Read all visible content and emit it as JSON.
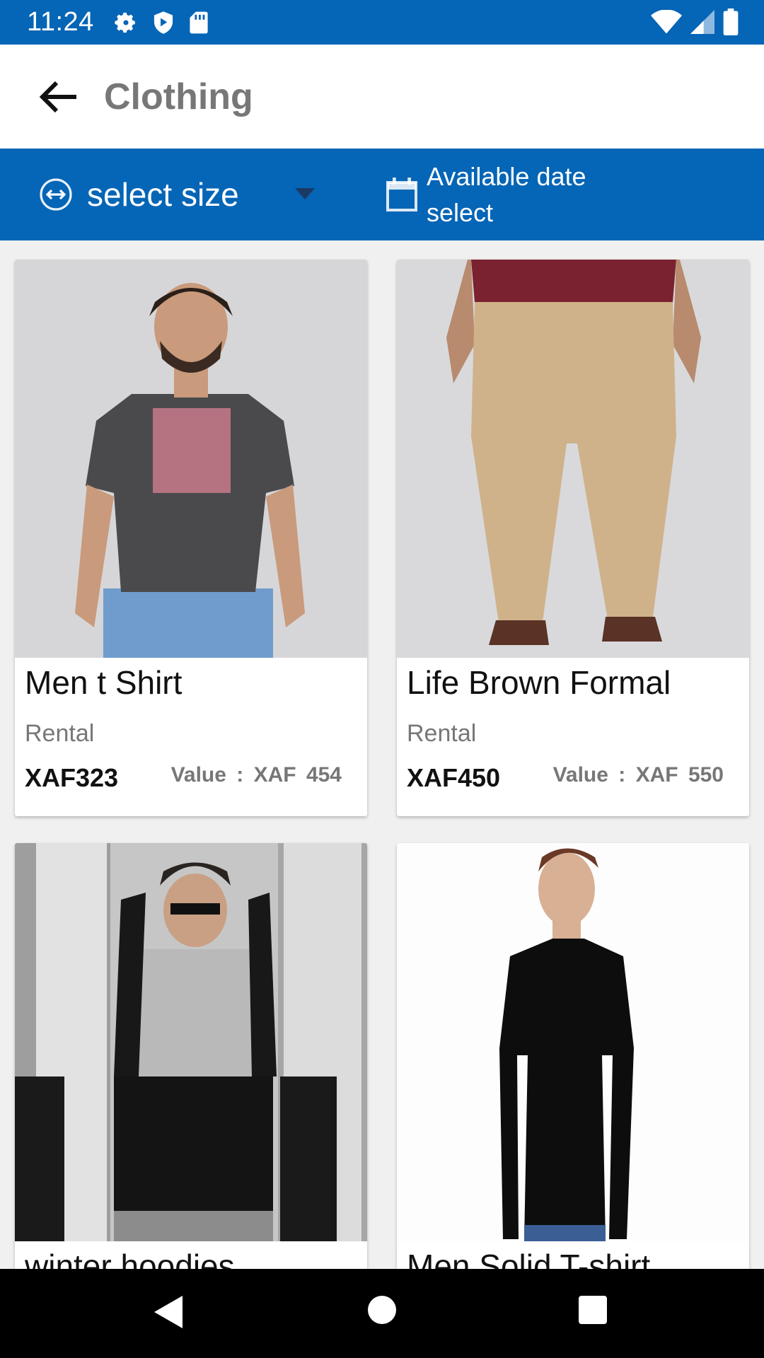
{
  "status_bar": {
    "time": "11:24"
  },
  "app_bar": {
    "title": "Clothing"
  },
  "filters": {
    "size_label": "select size",
    "date_label": "Available date select"
  },
  "products": [
    {
      "name": "Men t Shirt",
      "type": "Rental",
      "price": "XAF323",
      "value_label": "Value : XAF 454"
    },
    {
      "name": "Life Brown Formal",
      "type": "Rental",
      "price": "XAF450",
      "value_label": "Value : XAF 550"
    },
    {
      "name": "winter hoodies",
      "type": "",
      "price": "",
      "value_label": ""
    },
    {
      "name": "Men Solid T-shirt",
      "type": "",
      "price": "",
      "value_label": ""
    }
  ],
  "colors": {
    "primary": "#0565b6",
    "background": "#f0f0f0"
  },
  "icons": [
    "settings-icon",
    "shield-icon",
    "sd-card-icon",
    "wifi-icon",
    "signal-icon",
    "battery-icon",
    "back-arrow-icon",
    "resize-icon",
    "dropdown-caret-icon",
    "calendar-icon",
    "nav-back-icon",
    "nav-home-icon",
    "nav-recents-icon"
  ]
}
